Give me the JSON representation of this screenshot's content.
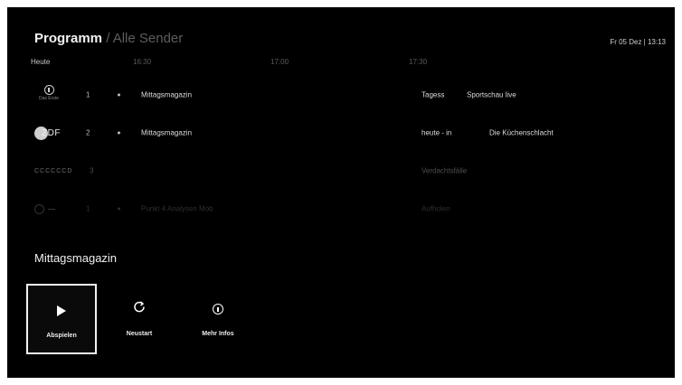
{
  "header": {
    "title": "Programm",
    "crumb": " / Alle Sender",
    "clock": "Fr 05 Dez | 13:13"
  },
  "timebar": {
    "day": "Heute",
    "times": [
      "16:30",
      "17:00",
      "17:30"
    ]
  },
  "channels": [
    {
      "number": "1",
      "logo_text": "Das Erste",
      "programs": [
        "Mittagsmagazin",
        "Tagess",
        "Sportschau live"
      ]
    },
    {
      "number": "2",
      "logo_text": "ZDF",
      "programs": [
        "Mittagsmagazin",
        "heute - in",
        "Die Küchenschlacht"
      ]
    },
    {
      "number": "3",
      "logo_text": "CCCCCCD",
      "programs": [
        "Verdachtsfälle"
      ]
    },
    {
      "number": "1",
      "programs": [
        "Punkt 4 Analysen Mob",
        "Aufholen"
      ]
    }
  ],
  "selected": {
    "title": "Mittagsmagazin"
  },
  "actions": {
    "play": "Abspielen",
    "restart": "Neustart",
    "info": "Mehr Infos"
  }
}
